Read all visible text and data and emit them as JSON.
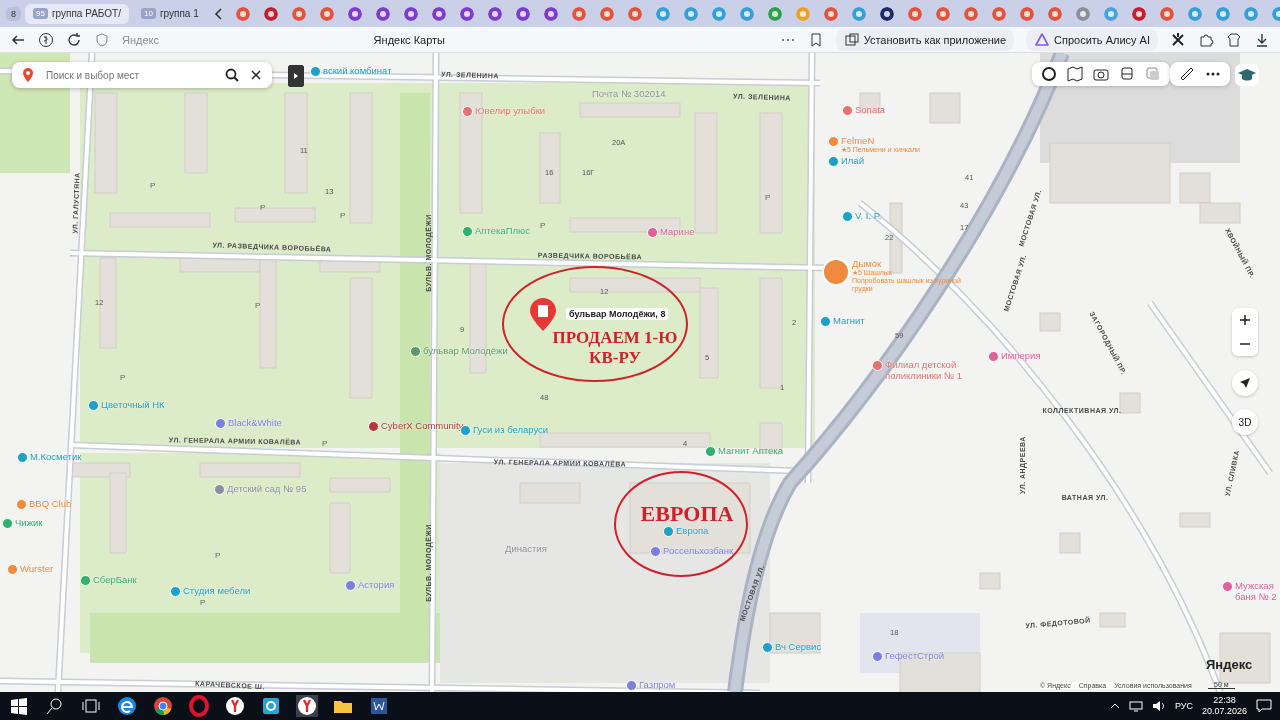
{
  "browser": {
    "group_badge": "8",
    "tabs": [
      {
        "count": "95",
        "title": "группа РАБОТ/",
        "selected": true
      },
      {
        "count": "10",
        "title": "группа 1",
        "selected": false
      }
    ],
    "address": "Яндекс",
    "page_title": "Яндекс Карты",
    "actions": [
      "Установить как приложение",
      "Спросить Алису AI"
    ]
  },
  "map": {
    "search": {
      "placeholder": "Поиск и выбор мест"
    },
    "streets": [
      "УЛ. ЗЕЛЕНИНА",
      "УЛ. ЗЕЛЕНИНА",
      "УЛ. РАЗВЕДЧИКА ВОРОБЬЁВА",
      "РАЗВЕДЧИКА ВОРОБЬЁВА",
      "УЛ. ГЕНЕРАЛА АРМИИ КОВАЛЁВА",
      "УЛ. ГЕНЕРАЛА АРМИИ КОВАЛЁВА",
      "БУЛЬВ. МОЛОДЁЖИ",
      "БУЛЬВ. МОЛОДЁЖИ",
      "УЛ. ГАЛУСТЯНА",
      "КАРАЧЕВСКОЕ Ш.",
      "МОСТОВАЯ УЛ.",
      "МОСТОВАЯ УЛ.",
      "МОСТОВАЯ УЛ.",
      "ЗАГОРОДНЫЙ ПР.",
      "ХВОЙНЫЙ ПР.",
      "КОЛЛЕКТИВНАЯ УЛ.",
      "ВАТНАЯ УЛ.",
      "УЛ. ФЕДОТОВОЙ",
      "УЛ. АНДРЕЕВА",
      "УЛ. СЛИВКА"
    ],
    "places": [
      {
        "label": "вский комбинат",
        "kind": "poi",
        "color": "#1ba2c6"
      },
      {
        "label": "Ювелир улыбки",
        "kind": "poi",
        "color": "#e8706f"
      },
      {
        "label": "Почта № 302014",
        "kind": "area"
      },
      {
        "label": "АптекаПлюс",
        "kind": "poi",
        "color": "#2fb36b"
      },
      {
        "label": "Марине",
        "kind": "poi",
        "color": "#e0609a"
      },
      {
        "label": "Sonata",
        "kind": "poi",
        "color": "#e8706f"
      },
      {
        "label": "FelmeN",
        "kind": "poi",
        "color": "#f08a3c",
        "details": [
          "★5 Пельмени и хинкали"
        ]
      },
      {
        "label": "Илай",
        "kind": "poi",
        "color": "#1ba2c6"
      },
      {
        "label": "V. I. P.",
        "kind": "poi",
        "color": "#1ba2c6"
      },
      {
        "label": "Дымок",
        "kind": "photo",
        "color": "#f08a3c",
        "details": [
          "★5 Шашлык",
          "Попробовать шашлык из куриной грудки"
        ]
      },
      {
        "label": "Магнит",
        "kind": "poi",
        "color": "#1ba2c6"
      },
      {
        "label": "Филиал детской поликлиники № 1",
        "kind": "poi",
        "color": "#e8706f"
      },
      {
        "label": "Империя",
        "kind": "poi",
        "color": "#e0609a"
      },
      {
        "label": "бульвар Молодёжи",
        "kind": "poi",
        "color": "#5a9a6a"
      },
      {
        "label": "Цветочный НК",
        "kind": "poi",
        "color": "#1ba2c6"
      },
      {
        "label": "Black&White",
        "kind": "poi",
        "color": "#7b7fe0"
      },
      {
        "label": "CyberX Community",
        "kind": "poi",
        "color": "#b33a3a"
      },
      {
        "label": "Гуси из беларуси",
        "kind": "poi",
        "color": "#1ba2c6"
      },
      {
        "label": "Магнит Аптека",
        "kind": "poi",
        "color": "#2fb36b"
      },
      {
        "label": "М.Косметик",
        "kind": "poi",
        "color": "#1ba2c6"
      },
      {
        "label": "Детский сад № 95",
        "kind": "poi",
        "color": "#8a8f99"
      },
      {
        "label": "BBQ Club",
        "kind": "poi",
        "color": "#f08a3c"
      },
      {
        "label": "Чижик",
        "kind": "poi",
        "color": "#2fb36b"
      },
      {
        "label": "Европа",
        "kind": "poi",
        "color": "#1ba2c6"
      },
      {
        "label": "Россельхозбанк",
        "kind": "poi",
        "color": "#7b7fe0"
      },
      {
        "label": "Династия",
        "kind": "area"
      },
      {
        "label": "Wurster",
        "kind": "poi",
        "color": "#f08a3c"
      },
      {
        "label": "СберБанк",
        "kind": "poi",
        "color": "#2fb36b"
      },
      {
        "label": "Студия мебели",
        "kind": "poi",
        "color": "#1ba2c6"
      },
      {
        "label": "Астория",
        "kind": "poi",
        "color": "#7b7fe0"
      },
      {
        "label": "Вч Сервис",
        "kind": "poi",
        "color": "#1ba2c6"
      },
      {
        "label": "ГефестСтрой",
        "kind": "poi",
        "color": "#7b7fe0"
      },
      {
        "label": "Газпром",
        "kind": "poi",
        "color": "#7b7fe0"
      },
      {
        "label": "Мужская баня № 2",
        "kind": "poi",
        "color": "#e0609a"
      }
    ],
    "house_numbers": [
      "11",
      "13",
      "16",
      "16Г",
      "20А",
      "12",
      "12",
      "9",
      "4",
      "5",
      "2",
      "1",
      "48",
      "59",
      "18",
      "22",
      "41",
      "43",
      "17"
    ],
    "parking_marks": [
      "P",
      "P",
      "P",
      "P",
      "P",
      "P",
      "P",
      "P",
      "P",
      "P"
    ],
    "pin": {
      "label": "бульвар Молодёжи, 8"
    },
    "annotations": [
      "ПРОДАЕМ 1-Ю КВ-РУ",
      "ЕВРОПА"
    ],
    "control_label": "3D",
    "logo": "Яндекс",
    "scale": "50 м",
    "footer_links": [
      "© Яндекс",
      "Справка",
      "Условия использования"
    ]
  },
  "taskbar": {
    "language": "РУС",
    "time": "22:38",
    "date": "20.07.2026"
  }
}
